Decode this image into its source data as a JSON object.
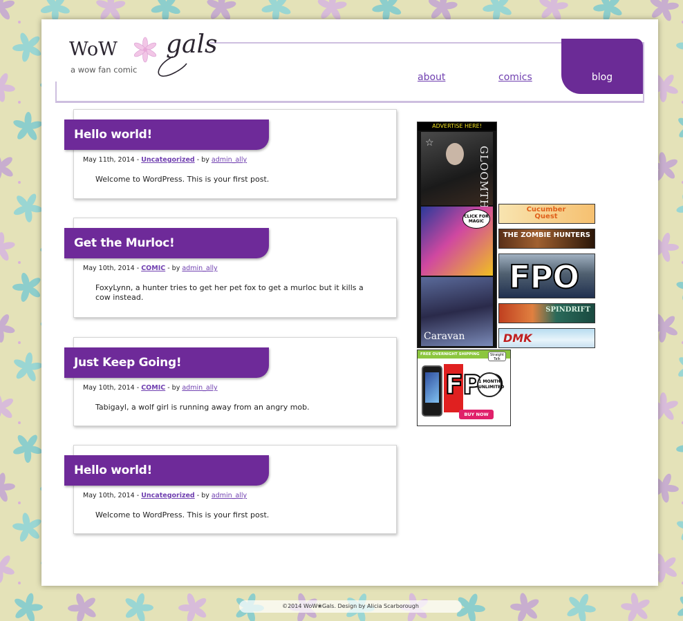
{
  "logo": {
    "wow": "WoW",
    "gals": "gals",
    "subtitle": "a wow fan comic"
  },
  "nav": {
    "about": "about",
    "comics": "comics",
    "blog": "blog"
  },
  "posts": [
    {
      "title": "Hello world!",
      "date": "May 11th, 2014",
      "category": "Uncategorized",
      "by": "by",
      "author": "admin_ally",
      "body": "Welcome to WordPress. This is your first post."
    },
    {
      "title": "Get the Murloc!",
      "date": "May 10th, 2014",
      "category": "COMIC",
      "by": "by",
      "author": "admin_ally",
      "body": "FoxyLynn, a hunter tries to get her pet fox to get a murloc but it kills a cow instead."
    },
    {
      "title": "Just Keep Going!",
      "date": "May 10th, 2014",
      "category": "COMIC",
      "by": "by",
      "author": "admin_ally",
      "body": "Tabigayl, a wolf girl is running away from an angry mob."
    },
    {
      "title": "Hello world!",
      "date": "May 10th, 2014",
      "category": "Uncategorized",
      "by": "by",
      "author": "admin_ally",
      "body": "Welcome to WordPress. This is your first post."
    }
  ],
  "ads": {
    "tall_header": "ADVERTISE HERE!",
    "gloomth": "GLOOMTH",
    "magic": "CLICK FOR MAGIC",
    "caravan": "Caravan",
    "cucumber": "Cucumber Quest",
    "zombie": "THE ZOMBIE HUNTERS",
    "fpo": "FPO",
    "spindrift": "SPINDRIFT",
    "dmk": "DMK",
    "phone_shipping": "FREE OVERNIGHT SHIPPING",
    "phone_brand": "Straight Talk",
    "phone_month": "1 MONTH",
    "phone_unlimited": "UNLIMITED",
    "phone_buy": "BUY NOW"
  },
  "footer": "©2014 WoW❀Gals. Design by Alicia Scarborough",
  "colors": {
    "accent": "#6e2a99",
    "link": "#7040b0",
    "background": "#e4e2b8",
    "frame": "#cdbedf"
  }
}
